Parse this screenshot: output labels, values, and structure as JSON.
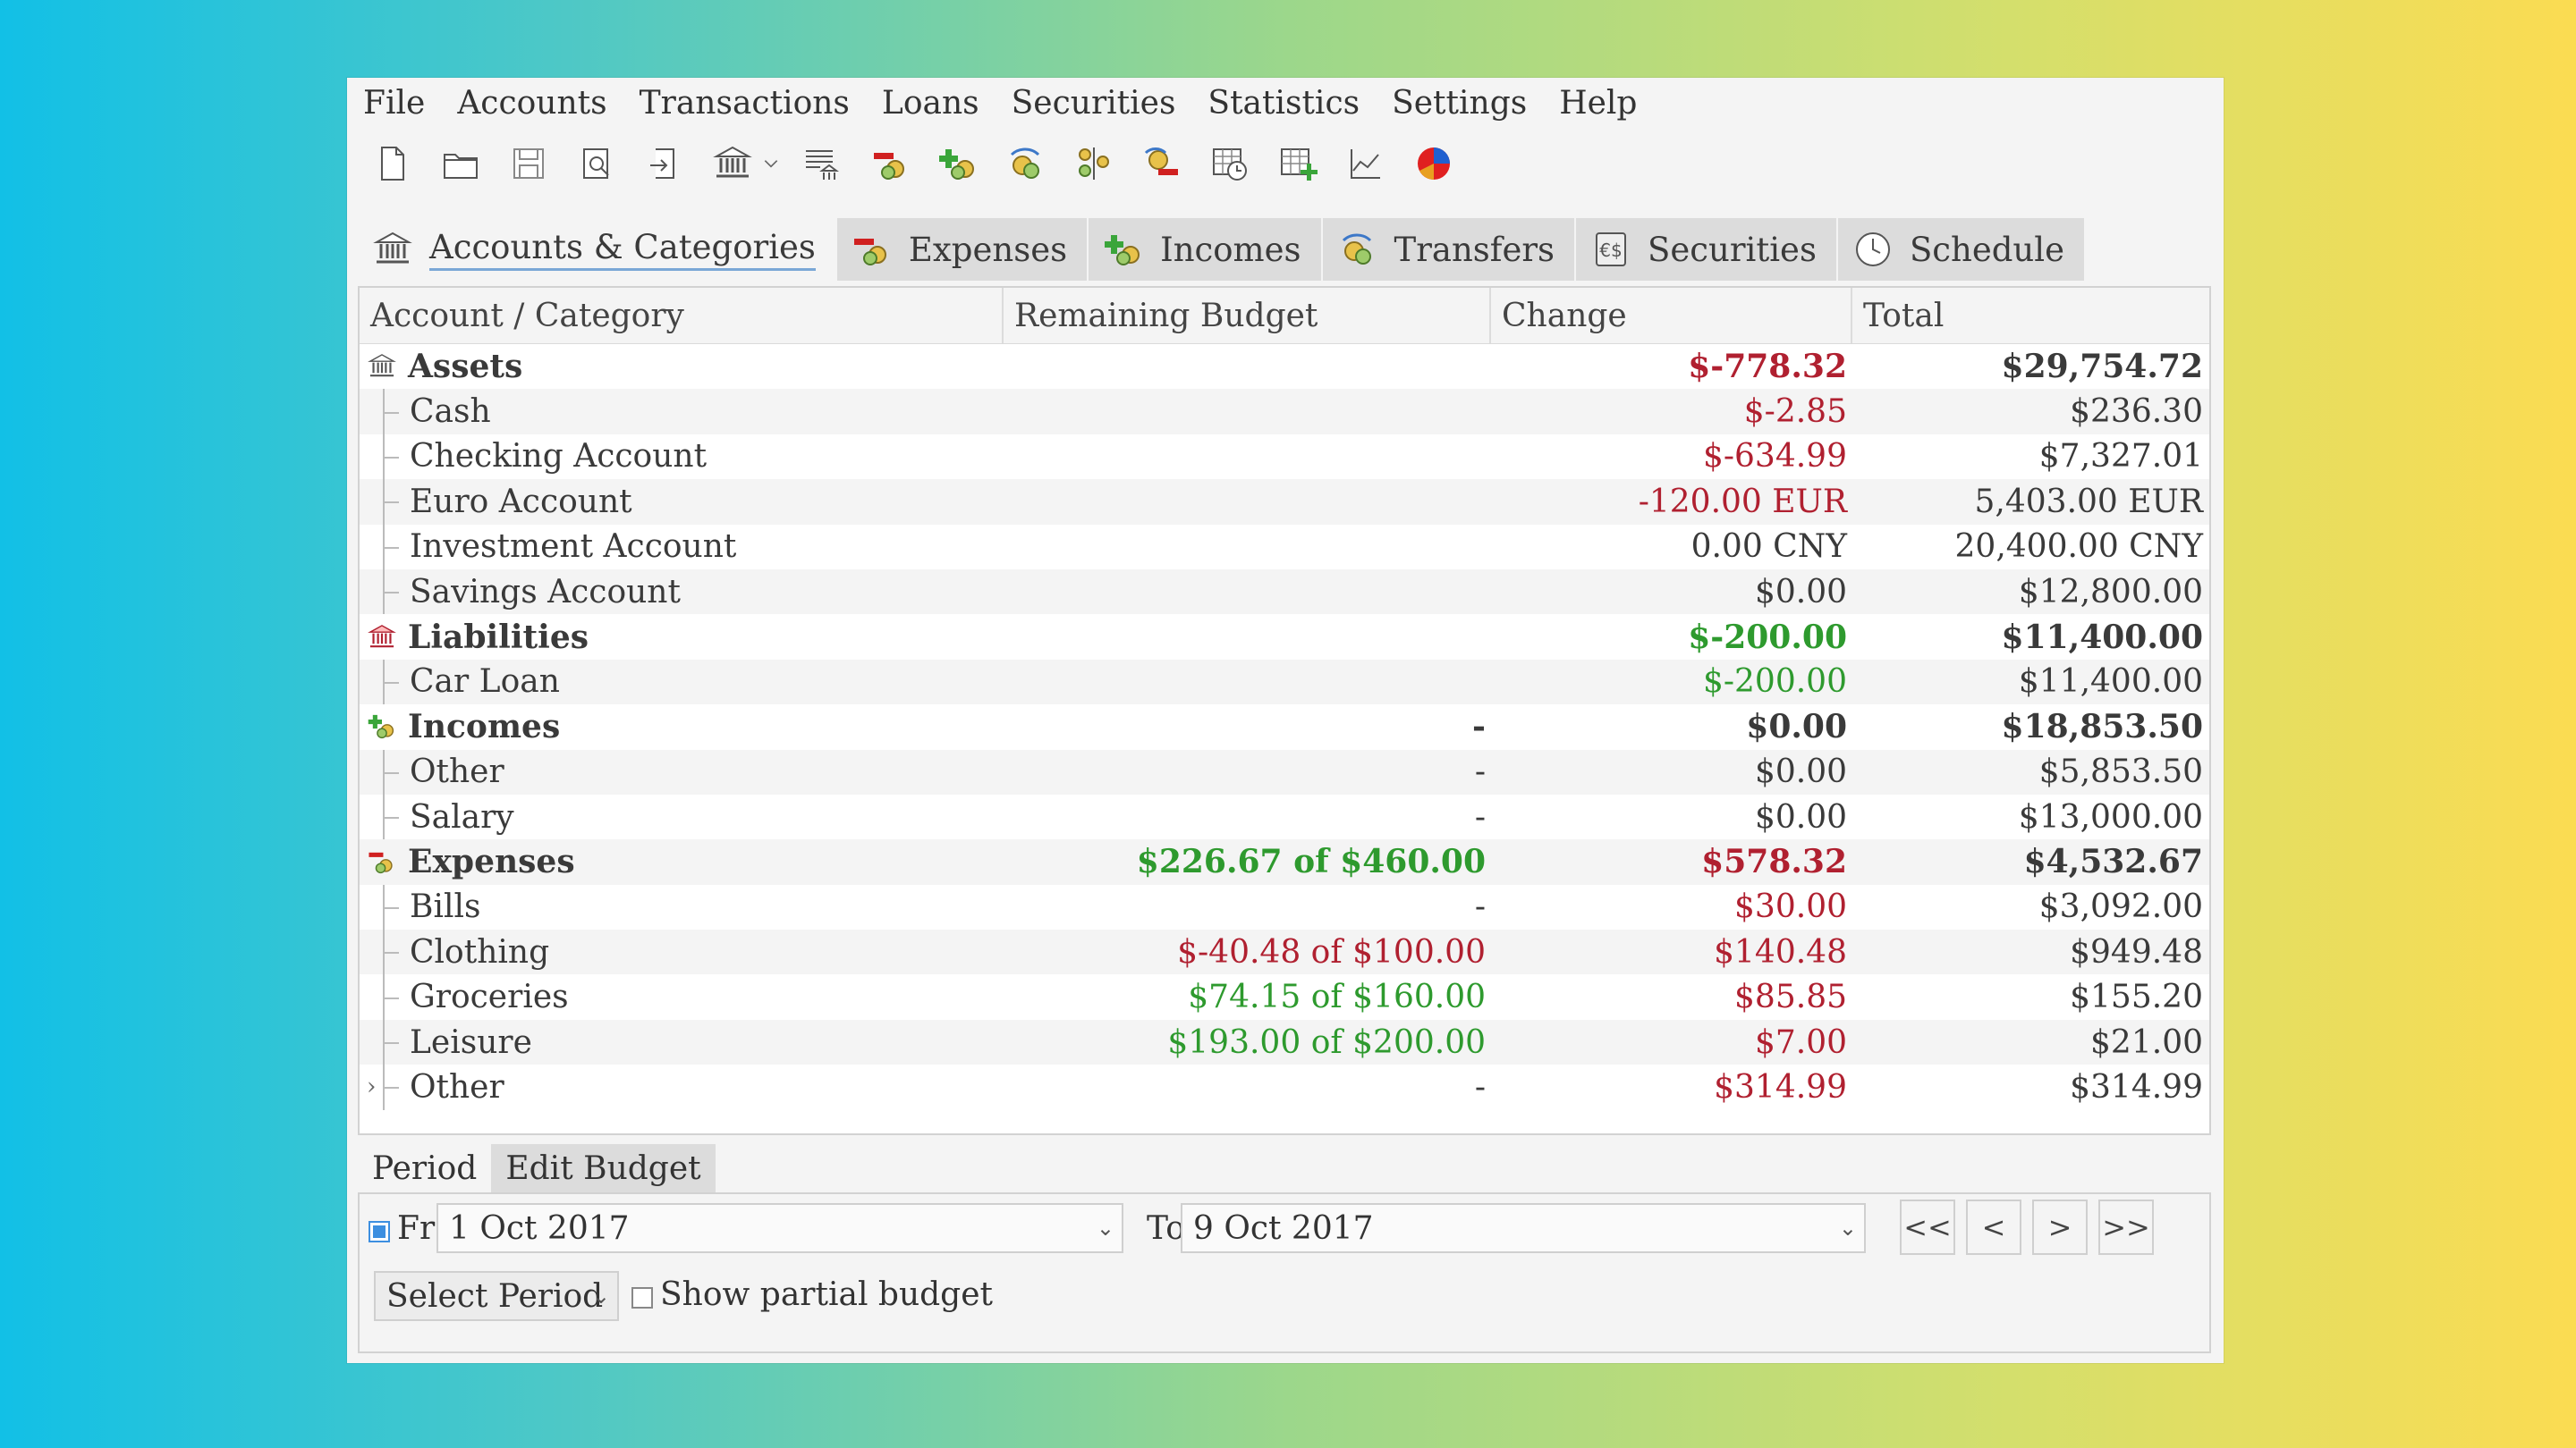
{
  "menu": [
    "File",
    "Accounts",
    "Transactions",
    "Loans",
    "Securities",
    "Statistics",
    "Settings",
    "Help"
  ],
  "tabs": [
    {
      "label": "Accounts & Categories",
      "icon": "bank-icon"
    },
    {
      "label": "Expenses",
      "icon": "expense-icon"
    },
    {
      "label": "Incomes",
      "icon": "income-icon"
    },
    {
      "label": "Transfers",
      "icon": "transfer-icon"
    },
    {
      "label": "Securities",
      "icon": "securities-icon"
    },
    {
      "label": "Schedule",
      "icon": "clock-icon"
    }
  ],
  "table": {
    "headers": [
      "Account / Category",
      "Remaining Budget",
      "Change",
      "Total"
    ],
    "rows": [
      {
        "name": "Assets",
        "budget": "",
        "change": "$-778.32",
        "total": "$29,754.72",
        "parent": true
      },
      {
        "name": "Cash",
        "budget": "",
        "change": "$-2.85",
        "total": "$236.30"
      },
      {
        "name": "Checking Account",
        "budget": "",
        "change": "$-634.99",
        "total": "$7,327.01"
      },
      {
        "name": "Euro Account",
        "budget": "",
        "change": "-120.00 EUR",
        "total": "5,403.00 EUR"
      },
      {
        "name": "Investment Account",
        "budget": "",
        "change": "0.00 CNY",
        "total": "20,400.00 CNY"
      },
      {
        "name": "Savings Account",
        "budget": "",
        "change": "$0.00",
        "total": "$12,800.00"
      },
      {
        "name": "Liabilities",
        "budget": "",
        "change": "$-200.00",
        "total": "$11,400.00",
        "parent": true
      },
      {
        "name": "Car Loan",
        "budget": "",
        "change": "$-200.00",
        "total": "$11,400.00"
      },
      {
        "name": "Incomes",
        "budget": "-",
        "change": "$0.00",
        "total": "$18,853.50",
        "parent": true
      },
      {
        "name": "Other",
        "budget": "-",
        "change": "$0.00",
        "total": "$5,853.50"
      },
      {
        "name": "Salary",
        "budget": "-",
        "change": "$0.00",
        "total": "$13,000.00"
      },
      {
        "name": "Expenses",
        "budget": "$226.67 of $460.00",
        "change": "$578.32",
        "total": "$4,532.67",
        "parent": true
      },
      {
        "name": "Bills",
        "budget": "-",
        "change": "$30.00",
        "total": "$3,092.00"
      },
      {
        "name": "Clothing",
        "budget": "$-40.48 of $100.00",
        "change": "$140.48",
        "total": "$949.48"
      },
      {
        "name": "Groceries",
        "budget": "$74.15 of $160.00",
        "change": "$85.85",
        "total": "$155.20"
      },
      {
        "name": "Leisure",
        "budget": "$193.00 of $200.00",
        "change": "$7.00",
        "total": "$21.00"
      },
      {
        "name": "Other",
        "budget": "-",
        "change": "$314.99",
        "total": "$314.99"
      }
    ]
  },
  "bottom": {
    "tabs": [
      "Period",
      "Edit Budget"
    ],
    "from_label": "From",
    "from_value": "1 Oct 2017",
    "to_label": "To",
    "to_value": "9 Oct 2017",
    "select_period": "Select Period",
    "show_partial": "Show partial budget",
    "nav": [
      "<<",
      "<",
      ">",
      ">>"
    ]
  },
  "colors": {
    "red": "#b02030",
    "green": "#2e9a2e",
    "accent": "#3d8fe0"
  }
}
